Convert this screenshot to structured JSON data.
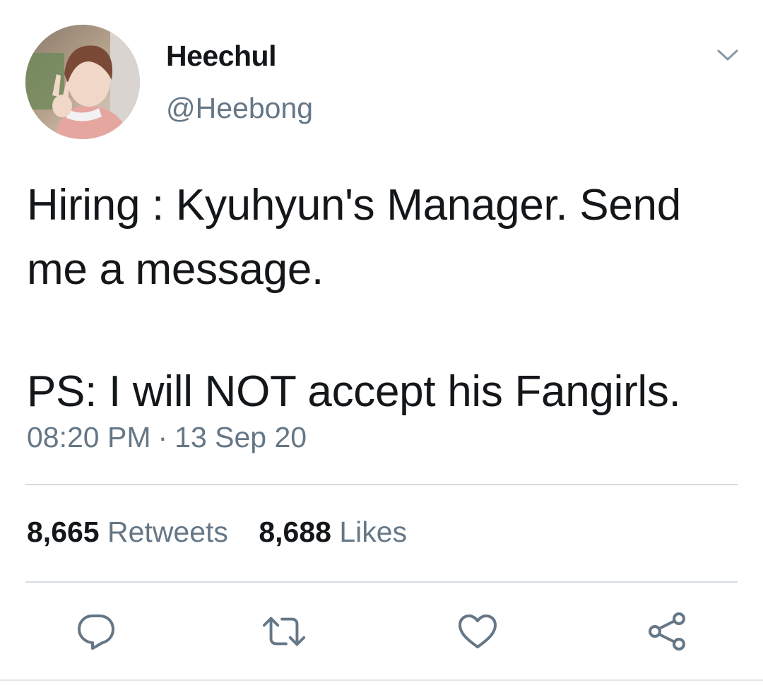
{
  "tweet": {
    "author": {
      "display_name": "Heechul",
      "handle": "@Heebong",
      "avatar_icon": "profile-photo"
    },
    "text_lines": [
      "Hiring : Kyuhyun's Manager. Send",
      "me a message.",
      "PS: I will NOT accept his Fangirls."
    ],
    "timestamp": {
      "time": "08:20 PM",
      "separator": "·",
      "date": "13 Sep 20"
    },
    "stats": {
      "retweets_count": "8,665",
      "retweets_label": "Retweets",
      "likes_count": "8,688",
      "likes_label": "Likes"
    },
    "actions": {
      "reply_icon": "reply-icon",
      "retweet_icon": "retweet-icon",
      "like_icon": "heart-icon",
      "share_icon": "share-icon",
      "menu_icon": "chevron-down-icon"
    }
  },
  "colors": {
    "text_primary": "#14171a",
    "text_secondary": "#657786",
    "divider": "#d3dbe2",
    "icon": "#657786"
  }
}
